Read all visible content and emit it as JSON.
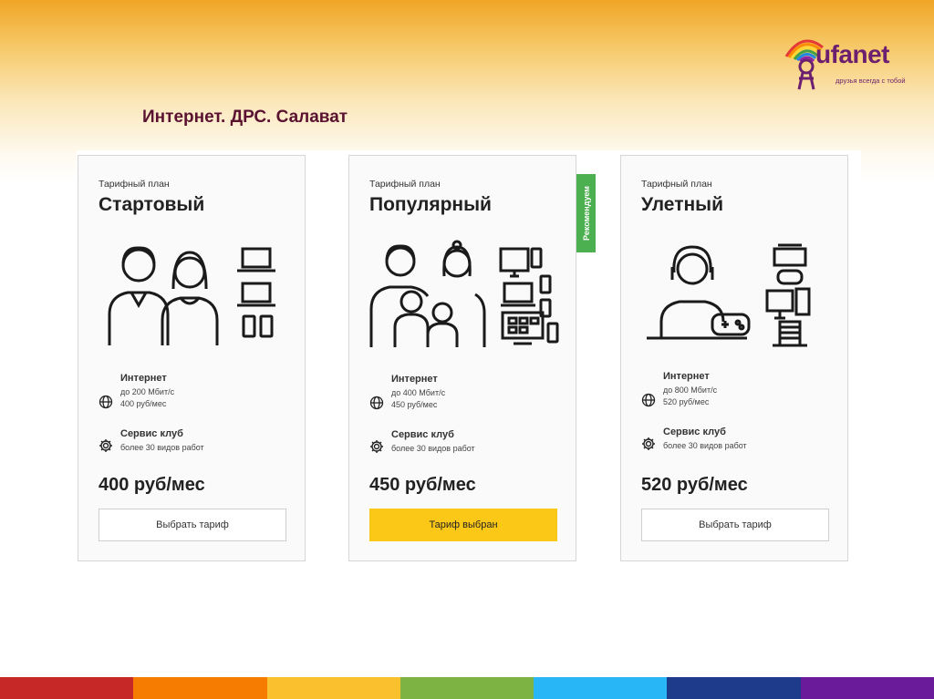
{
  "slide": {
    "title": "Интернет. ДРС. Салават"
  },
  "logo": {
    "name": "ufanet",
    "tagline": "друзья всегда с тобой"
  },
  "cards": [
    {
      "label": "Тарифный план",
      "name": "Стартовый",
      "internet_title": "Интернет",
      "internet_speed": "до 200 Мбит/с",
      "internet_price": "400 руб/мес",
      "service_title": "Сервис клуб",
      "service_desc": "более 30 видов работ",
      "price": "400 руб/мес",
      "button": "Выбрать тариф"
    },
    {
      "label": "Тарифный план",
      "name": "Популярный",
      "internet_title": "Интернет",
      "internet_speed": "до 400 Мбит/с",
      "internet_price": "450 руб/мес",
      "service_title": "Сервис клуб",
      "service_desc": "более 30 видов работ",
      "price": "450 руб/мес",
      "button": "Тариф выбран",
      "badge": "Рекомендуем"
    },
    {
      "label": "Тарифный план",
      "name": "Улетный",
      "internet_title": "Интернет",
      "internet_speed": "до 800 Мбит/с",
      "internet_price": "520 руб/мес",
      "service_title": "Сервис клуб",
      "service_desc": "более 30 видов работ",
      "price": "520 руб/мес",
      "button": "Выбрать тариф"
    }
  ],
  "colors": {
    "accent_yellow": "#fcc817",
    "badge_green": "#4caf50",
    "title_color": "#5a1230",
    "logo_purple": "#6b1f6e",
    "bottom_stripes": [
      "#c62828",
      "#f57c00",
      "#fbc02d",
      "#7cb342",
      "#29b6f6",
      "#1e3a8a",
      "#6a1b9a"
    ]
  },
  "icons": [
    "globe-icon",
    "gear-icon",
    "rainbow-logo-icon"
  ]
}
